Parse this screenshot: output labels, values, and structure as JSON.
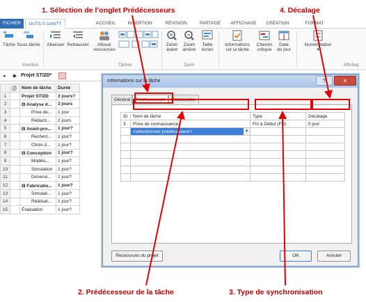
{
  "annotations": {
    "a1": "1. Sélection de l’onglet Prédécesseurs",
    "a2": "2. Prédécesseur  de la tâche",
    "a3": "3. Type de synchronisation",
    "a4": "4. Décalage"
  },
  "ribbon": {
    "tabs": [
      "FICHIER",
      "OUTILS GANTT",
      "ACCUEIL",
      "INSERTION",
      "RÉVISION",
      "PARTAGE",
      "AFFICHAGE",
      "CRÉATION",
      "FORMAT"
    ],
    "buttons": {
      "tache": "Tâche",
      "sous_tache": "Sous-tâche",
      "abaisser": "Abaisser",
      "rehausser": "Rehausser",
      "allouer1": "Allouer",
      "allouer2": "ressources",
      "zoom_avant1": "Zoom",
      "zoom_avant2": "avant",
      "zoom_arriere1": "Zoom",
      "zoom_arriere2": "arrière",
      "taille1": "Taille",
      "taille2": "écran",
      "info1": "Informations",
      "info2": "sur la tâche",
      "chemin1": "Chemin",
      "chemin2": "critique",
      "date1": "Date",
      "date2": "du jour",
      "numerotation": "Numérotation"
    },
    "groups": {
      "insertion": "Insertion",
      "taches": "Tâches",
      "zoom": "Zoom",
      "affichage": "Affichag"
    }
  },
  "view": {
    "project_tab": "Projet STI2D*"
  },
  "grid": {
    "headers": [
      "Nom de tâche",
      "Durée"
    ],
    "rows": [
      {
        "n": "1",
        "name": "Projet STI2D",
        "dur": "3 jours?",
        "bold": true,
        "indent": 0
      },
      {
        "n": "2",
        "name": "⊟ Analyse d...",
        "dur": "3 jours",
        "bold": true,
        "indent": 0
      },
      {
        "n": "3",
        "name": "Prise de...",
        "dur": "1 jour",
        "bold": false,
        "indent": 1
      },
      {
        "n": "4",
        "name": "Rédacti...",
        "dur": "2 jours",
        "bold": false,
        "indent": 1
      },
      {
        "n": "5",
        "name": "⊟ Avant-pro...",
        "dur": "1 jour?",
        "bold": true,
        "indent": 0
      },
      {
        "n": "6",
        "name": "Recherc...",
        "dur": "1 jour?",
        "bold": false,
        "indent": 1
      },
      {
        "n": "7",
        "name": "Choix d...",
        "dur": "1 jour?",
        "bold": false,
        "indent": 1
      },
      {
        "n": "8",
        "name": "⊟ Conception",
        "dur": "1 jour?",
        "bold": true,
        "indent": 0
      },
      {
        "n": "9",
        "name": "Modèls...",
        "dur": "1 jour?",
        "bold": false,
        "indent": 1
      },
      {
        "n": "10",
        "name": "Simulation",
        "dur": "1 jour?",
        "bold": false,
        "indent": 1
      },
      {
        "n": "11",
        "name": "Dimensi...",
        "dur": "1 jour?",
        "bold": false,
        "indent": 1
      },
      {
        "n": "12",
        "name": "⊟ Fabricatio...",
        "dur": "1 jour?",
        "bold": true,
        "indent": 0
      },
      {
        "n": "13",
        "name": "Simulati...",
        "dur": "1 jour?",
        "bold": false,
        "indent": 1
      },
      {
        "n": "14",
        "name": "Réalisat...",
        "dur": "1 jour?",
        "bold": false,
        "indent": 1
      },
      {
        "n": "15",
        "name": "Évaluation",
        "dur": "1 jour?",
        "bold": false,
        "indent": 0
      }
    ]
  },
  "dialog": {
    "title": "Informations sur la tâche",
    "tabs": [
      "Général",
      "Prédécesseurs",
      "Ressources"
    ],
    "columns": [
      "ID",
      "Nom de tâche",
      "Type",
      "Décalage"
    ],
    "row": {
      "id": "3",
      "name": "Prise de connaissance",
      "type": "Fin à Début (FD)",
      "lag": "0 jour"
    },
    "new_row_placeholder": "<sélectionnez prédécesseur>",
    "resources_button": "Ressources du projet",
    "ok": "OK",
    "cancel": "Annuler",
    "help": "?",
    "close": "✕"
  },
  "colors": {
    "accent": "#2f6fb7",
    "annotation": "#c00000",
    "highlight": "#e00000"
  }
}
